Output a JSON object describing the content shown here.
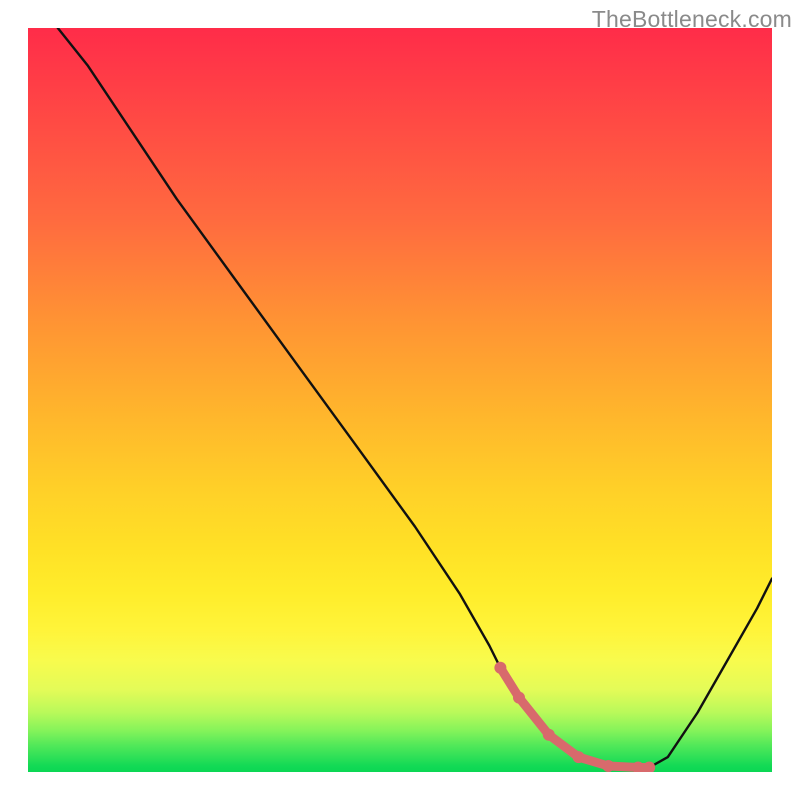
{
  "watermark": "TheBottleneck.com",
  "colors": {
    "curve": "#111111",
    "dot": "#d86a6c",
    "gradient_top": "#ff2c49",
    "gradient_bottom": "#0ad754"
  },
  "chart_data": {
    "type": "line",
    "title": "",
    "xlabel": "",
    "ylabel": "",
    "xlim": [
      0,
      100
    ],
    "ylim": [
      0,
      100
    ],
    "grid": false,
    "legend": false,
    "x": [
      4,
      8,
      14,
      20,
      28,
      36,
      44,
      52,
      58,
      62,
      63.5,
      66,
      70,
      74,
      78,
      82,
      83.5,
      86,
      90,
      94,
      98,
      100
    ],
    "values": [
      100,
      95,
      86,
      77,
      66,
      55,
      44,
      33,
      24,
      17,
      14,
      10,
      5,
      2,
      0.8,
      0.6,
      0.6,
      2,
      8,
      15,
      22,
      26
    ],
    "series": [
      {
        "name": "highlight-dots",
        "x": [
          63.5,
          66,
          70,
          74,
          78,
          82,
          83.5
        ],
        "values": [
          14,
          10,
          5,
          2,
          0.8,
          0.6,
          0.6
        ]
      }
    ],
    "annotations": []
  }
}
